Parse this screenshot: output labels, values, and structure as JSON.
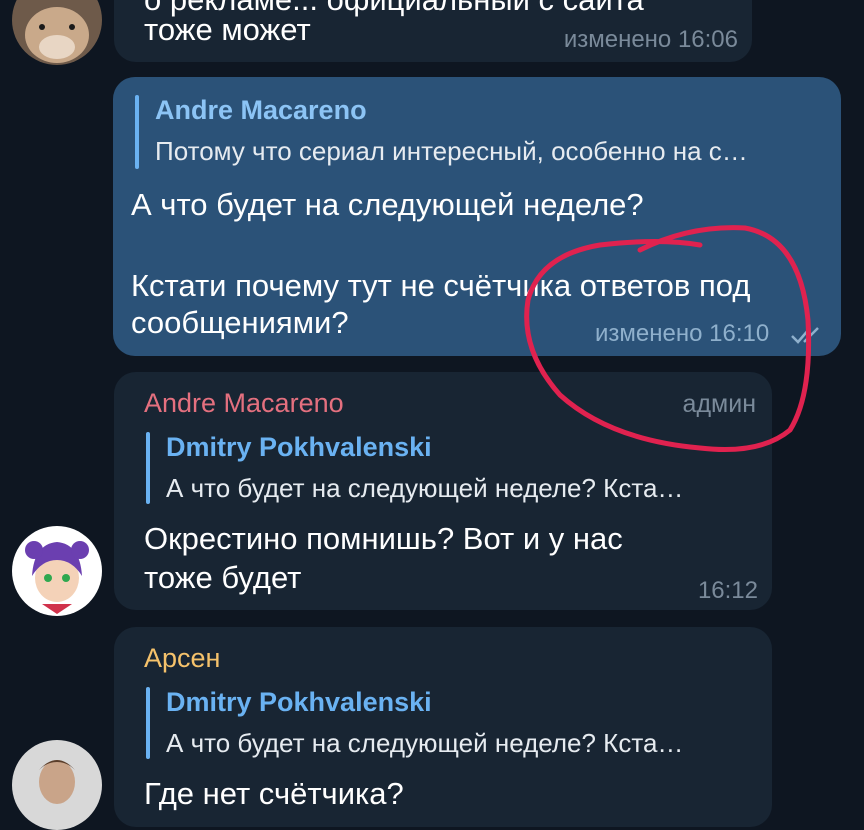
{
  "colors": {
    "background": "#0e1621",
    "incoming_bubble": "#182533",
    "outgoing_bubble": "#2b5278",
    "reply_bar": "#6ab2f2",
    "sender_andre": "#e4707f",
    "sender_arsen": "#f5c26b",
    "scribble": "#e0224f"
  },
  "messages": [
    {
      "text_line1": "о рекламе... официальный с сайта",
      "text_line2": "тоже может",
      "edited": "изменено 16:06"
    },
    {
      "reply_name": "Andre Macareno",
      "reply_text": "Потому что сериал интересный, особенно на с…",
      "line1": "А что будет на следующей неделе?",
      "line2": "Кстати почему тут не счётчика ответов под",
      "line3": "сообщениями?",
      "edited": "изменено 16:10",
      "status_icon": "double-check-icon"
    },
    {
      "sender": "Andre Macareno",
      "role": "админ",
      "reply_name": "Dmitry Pokhvalenski",
      "reply_text": "А что будет на следующей неделе?  Кста…",
      "line1": "Окрестино помнишь? Вот и у нас",
      "line2": "тоже будет",
      "time": "16:12"
    },
    {
      "sender": "Арсен",
      "reply_name": "Dmitry Pokhvalenski",
      "reply_text": "А что будет на следующей неделе?  Кста…",
      "line1": "Где нет счётчика?"
    }
  ]
}
